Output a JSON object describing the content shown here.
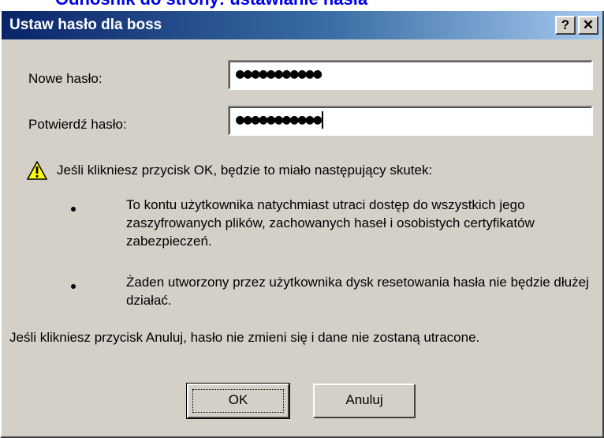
{
  "top_strip_text": "Odnośnik do strony: ustawianie hasła",
  "dialog": {
    "title": "Ustaw hasło dla boss",
    "help_button": "?",
    "close_button": "✕"
  },
  "form": {
    "new_password_label": "Nowe hasło:",
    "new_password_value": "●●●●●●●●●●●",
    "confirm_password_label": "Potwierdź hasło:",
    "confirm_password_value": "●●●●●●●●●●●"
  },
  "warning": {
    "icon": "warning-triangle-icon",
    "intro": "Jeśli klikniesz przycisk OK, będzie to miało następujący skutek:",
    "bullets": [
      "To kontu użytkownika natychmiast utraci dostęp do wszystkich jego zaszyfrowanych plików, zachowanych haseł i osobistych certyfikatów zabezpieczeń.",
      "Żaden utworzony przez użytkownika dysk resetowania hasła nie będzie dłużej działać."
    ],
    "cancel_note": "Jeśli klikniesz przycisk Anuluj, hasło nie zmieni się i dane nie zostaną utracone."
  },
  "buttons": {
    "ok": "OK",
    "cancel": "Anuluj"
  },
  "colors": {
    "titlebar_start": "#0a246a",
    "titlebar_end": "#a6caf0",
    "dialog_face": "#d4d0c8",
    "warning_yellow": "#ffff00"
  }
}
